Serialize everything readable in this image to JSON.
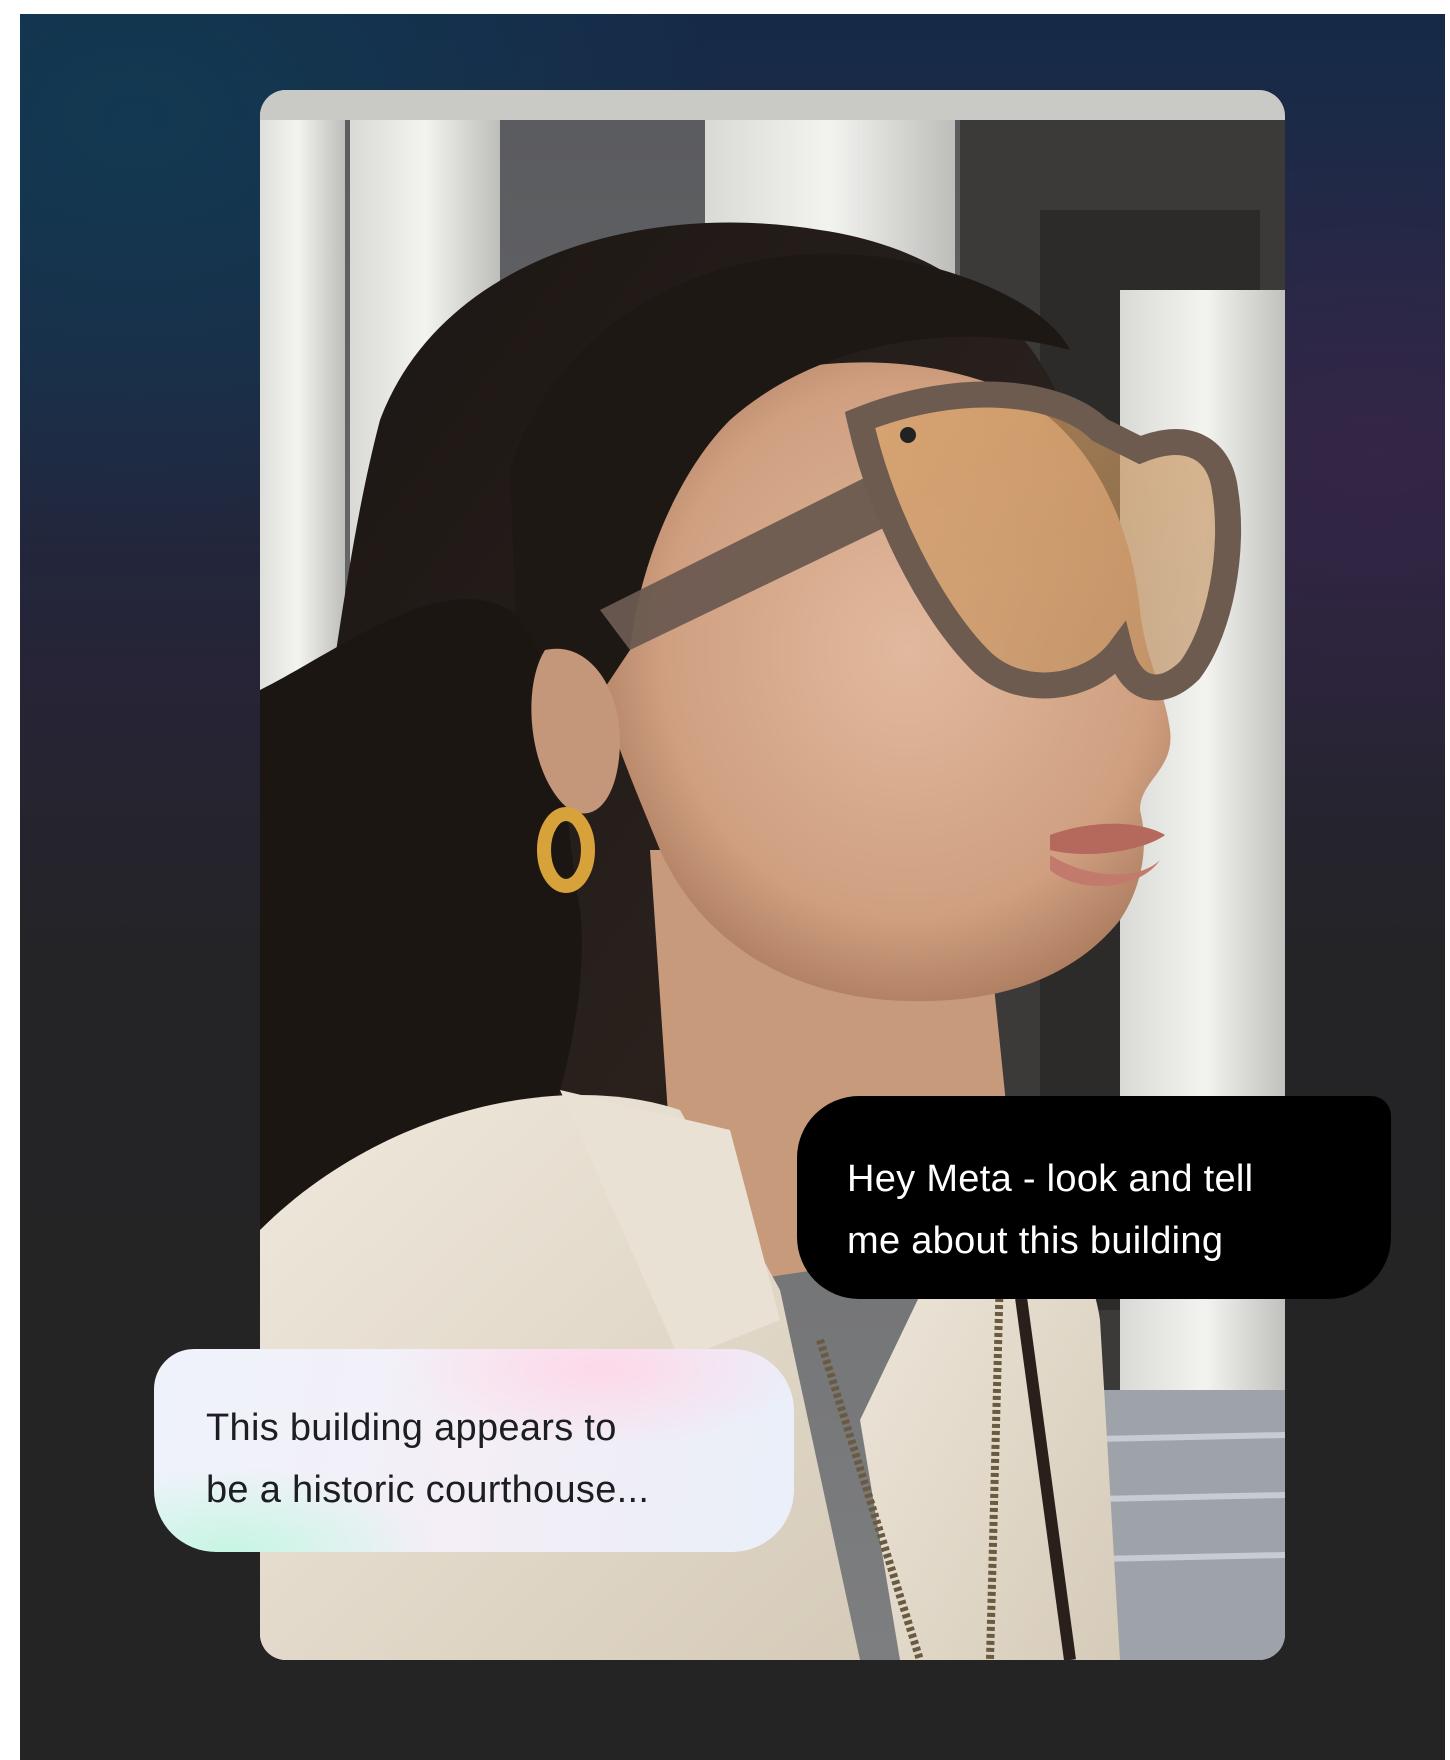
{
  "page": {
    "background_top": "#162a48",
    "background_bottom": "#242424"
  },
  "photo": {
    "subject_icon": "woman-wearing-smart-glasses"
  },
  "conversation": {
    "user_message": {
      "line_1": "Hey Meta - look and tell",
      "line_2": "me about this building",
      "bubble_color": "#000000"
    },
    "assistant_message": {
      "line_1": "This building appears to",
      "line_2": "be a historic courthouse...",
      "bubble_color": "#eef3fb"
    }
  }
}
